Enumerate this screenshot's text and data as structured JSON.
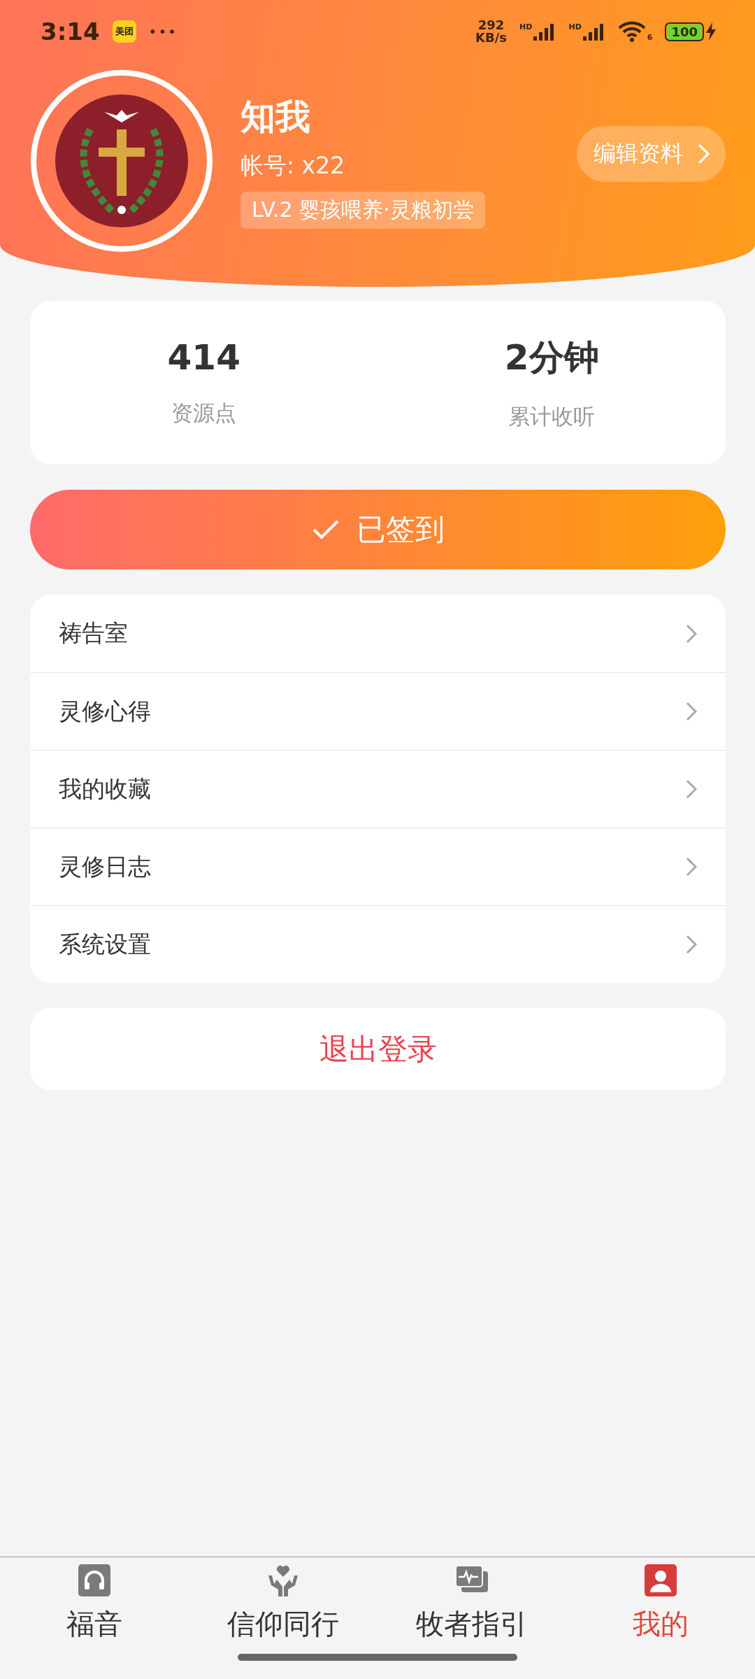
{
  "status_bar": {
    "time": "3:14",
    "app_badge": "美团",
    "more": "•••",
    "speed_value": "292",
    "speed_unit": "KB/s",
    "network_labels": [
      "HD",
      "HD"
    ],
    "wifi_label": "6",
    "battery": "100"
  },
  "profile": {
    "name": "知我",
    "account": "帐号: x22",
    "level_badge": "LV.2 婴孩喂养·灵粮初尝",
    "edit_button": "编辑资料"
  },
  "stats": [
    {
      "value": "414",
      "label": "资源点"
    },
    {
      "value": "2分钟",
      "label": "累计收听"
    }
  ],
  "checkin": {
    "label": "已签到",
    "checked": true
  },
  "menu": [
    {
      "label": "祷告室"
    },
    {
      "label": "灵修心得"
    },
    {
      "label": "我的收藏"
    },
    {
      "label": "灵修日志"
    },
    {
      "label": "系统设置"
    }
  ],
  "logout": "退出登录",
  "tab_bar": [
    {
      "label": "福音",
      "kind": "headphones",
      "selected": false
    },
    {
      "label": "信仰同行",
      "kind": "hands",
      "selected": false
    },
    {
      "label": "牧者指引",
      "kind": "chat",
      "selected": false
    },
    {
      "label": "我的",
      "kind": "person",
      "selected": true
    }
  ]
}
